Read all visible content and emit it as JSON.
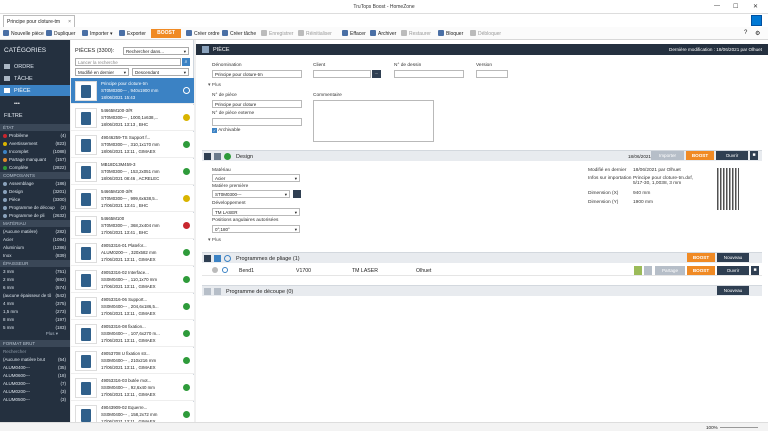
{
  "app": {
    "title": "TruTops Boost - HomeZone",
    "tab": "Principe pour cloture-tm",
    "tab_close": "×",
    "win_min": "—",
    "win_max": "☐",
    "win_close": "✕"
  },
  "toolbar": {
    "new": "Nouvelle pièce",
    "dup": "Dupliquer",
    "import": "Importer",
    "export": "Exporter",
    "boost": "BOOST",
    "create_order": "Créer ordre",
    "create_task": "Créer tâche",
    "save": "Enregistrer",
    "reinit": "Réinitialiser",
    "delete": "Effacer",
    "archive": "Archiver",
    "restore": "Restaurer",
    "lock": "Bloquer",
    "unlock": "Débloquer",
    "help": "?",
    "settings": "⚙"
  },
  "sidebar": {
    "categories": "CATÉGORIES",
    "nav": [
      "ORDRE",
      "TÂCHE",
      "PIÈCE"
    ],
    "more": "•••",
    "filter": "FILTRE",
    "sec_state": "ÉTAT",
    "states": [
      {
        "label": "Problème",
        "count": "(4)"
      },
      {
        "label": "Avertissement",
        "count": "(823)"
      },
      {
        "label": "Incomplet",
        "count": "(1088)"
      },
      {
        "label": "Partage manquant",
        "count": "(157)"
      },
      {
        "label": "Complète",
        "count": "(2822)"
      }
    ],
    "sec_comp": "COMPOSANTS",
    "comps": [
      {
        "label": "Assemblage",
        "count": "(186)"
      },
      {
        "label": "Design",
        "count": "(3201)"
      },
      {
        "label": "Pièce",
        "count": "(3300)"
      },
      {
        "label": "Programme de découp",
        "count": "(2)"
      },
      {
        "label": "Programme de pli",
        "count": "(2632)"
      }
    ],
    "sec_mat": "MATÉRIAU",
    "mats": [
      {
        "label": "(Aucune matière)",
        "count": "(282)"
      },
      {
        "label": "Acier",
        "count": "(1094)"
      },
      {
        "label": "Aluminium",
        "count": "(1286)"
      },
      {
        "label": "Inox",
        "count": "(839)"
      }
    ],
    "sec_ep": "ÉPAISSEUR",
    "eps": [
      {
        "label": "3 mm",
        "count": "(751)"
      },
      {
        "label": "2 mm",
        "count": "(692)"
      },
      {
        "label": "6 mm",
        "count": "(574)"
      },
      {
        "label": "(aucune épaisseur de tô",
        "count": "(542)"
      },
      {
        "label": "4 mm",
        "count": "(375)"
      },
      {
        "label": "1,5 mm",
        "count": "(273)"
      },
      {
        "label": "8 mm",
        "count": "(197)"
      },
      {
        "label": "5 mm",
        "count": "(183)"
      }
    ],
    "plus": "Plus ▾",
    "sec_fmt": "FORMAT BRUT",
    "fmt_search": "Rechercher",
    "fmts": [
      {
        "label": "(Aucune matière brut",
        "count": "(54)"
      },
      {
        "label": "ALUM0400---",
        "count": "(35)"
      },
      {
        "label": "ALUM0600---",
        "count": "(18)"
      },
      {
        "label": "ALUM0300---",
        "count": "(7)"
      },
      {
        "label": "ALUM0200---",
        "count": "(3)"
      },
      {
        "label": "ALUM0500---",
        "count": "(3)"
      }
    ]
  },
  "list": {
    "title": "PIÈCES (3300):",
    "search_scope": "Rechercher dans...",
    "search_placeholder": "Lancer la recherche",
    "sort": "Modifié en dernier",
    "order": "Descendant",
    "items": [
      {
        "l1": "Principe pour cloture-tm",
        "l2": "ST0M0300--- , 940x1900 mm",
        "l3": "18/06/2021 15:43",
        "status": "#ffffff"
      },
      {
        "l1": "54665M100-3/R",
        "l2": "ST0M0300--- , 1000,1x638,...",
        "l3": "18/06/2021 13:13 , BHC",
        "status": "#d9b400"
      },
      {
        "l1": "49046259-TS Support f...",
        "l2": "ST0M0300--- , 310,1x170 mm",
        "l3": "18/06/2021 13:11 , GIMAEX",
        "status": "#2e9b3a"
      },
      {
        "l1": "MB18D13M459-3",
        "l2": "ST0M0300--- , 153,2x051 mm",
        "l3": "18/06/2021 08:46 , ACRELEC",
        "status": "#2e9b3a"
      },
      {
        "l1": "54665M100-3/R",
        "l2": "ST0M0300--- , 999,6x638,5...",
        "l3": "17/06/2021 13:41 , BHC",
        "status": "#d9b400"
      },
      {
        "l1": "54665M100",
        "l2": "ST0M0300--- , 368,2x404 mm",
        "l3": "17/06/2021 13:41 , BHC",
        "status": "#c8262e"
      },
      {
        "l1": "49053316-01 Platefor...",
        "l2": "ALUM0200--- , 320x582 mm",
        "l3": "17/06/2021 13:11 , GIMAEX",
        "status": "#2e9b3a"
      },
      {
        "l1": "49053316-02 Interface...",
        "l2": "SS0M0400--- , 110,1x70 mm",
        "l3": "17/06/2021 13:11 , GIMAEX",
        "status": "#2e9b3a"
      },
      {
        "l1": "49053316-06 Support...",
        "l2": "SS0M0400--- , 204,6x186,5...",
        "l3": "17/06/2021 13:11 , GIMAEX",
        "status": "#2e9b3a"
      },
      {
        "l1": "49053316-08 fixation...",
        "l2": "SS0M0400--- , 107,6x270 m...",
        "l3": "17/06/2021 13:11 , GIMAEX",
        "status": "#2e9b3a"
      },
      {
        "l1": "49053708 U fixation str...",
        "l2": "SS0M0400--- , 210x216 mm",
        "l3": "17/06/2021 13:11 , GIMAEX",
        "status": "#2e9b3a"
      },
      {
        "l1": "49053316-03 butée mot...",
        "l2": "SS0M0400--- , 92,6x40 mm",
        "l3": "17/06/2021 13:11 , GIMAEX",
        "status": "#2e9b3a"
      },
      {
        "l1": "49043909-02 Equerre...",
        "l2": "SS0M0400--- , 158,2x72 mm",
        "l3": "17/06/2021 13:11 , GIMAEX",
        "status": "#2e9b3a"
      }
    ]
  },
  "main": {
    "head": "PIÈCE",
    "last_mod": "Dernière modification : 18/06/2021 par Olhuet",
    "denom_label": "Dénomination",
    "denom": "Principe pour cloture-tm",
    "client_label": "Client",
    "drawing_label": "N° de dessin",
    "version_label": "Version",
    "plus": "Plus",
    "piece_no_label": "N° de pièce",
    "piece_no": "Principe pour cloture",
    "ext_label": "N° de pièce externe",
    "archivable": "Archivable",
    "notes_label": "Commentaire",
    "design": {
      "title": "Design",
      "date": "18/06/2021",
      "import": "Importer",
      "boost": "BOOST",
      "open": "Ouvrir",
      "mat_label": "Matériau",
      "mat": "Acier",
      "raw_label": "Matière première",
      "raw": "ST0M0300---",
      "dev_label": "Développement",
      "dev": "TM LASER",
      "angle_label": "Positions angulaires autorisées",
      "angle": "0°;180°",
      "plus": "Plus",
      "info": [
        {
          "k": "Modifié en dernier",
          "v": "18/06/2021 par Olhuet"
        },
        {
          "k": "Infos sur importation",
          "v": "Principe pour cloture-tm.dxf, 5/17-30, 1,0038, 3 mm"
        },
        {
          "k": "Dimension (X)",
          "v": "940 mm"
        },
        {
          "k": "Dimension (Y)",
          "v": "1900 mm"
        }
      ]
    },
    "bend": {
      "title": "Programmes de pliage (1)",
      "boost": "BOOST",
      "new": "Nouveau",
      "row_name": "Bend1",
      "row_machine": "V1700",
      "row_tool": "TM LASER",
      "row_user": "Olhuet",
      "share": "Partage",
      "open": "Ouvrir"
    },
    "cut": {
      "title": "Programme de découpe (0)",
      "new": "Nouveau"
    }
  },
  "status": {
    "zoom": "100%"
  }
}
